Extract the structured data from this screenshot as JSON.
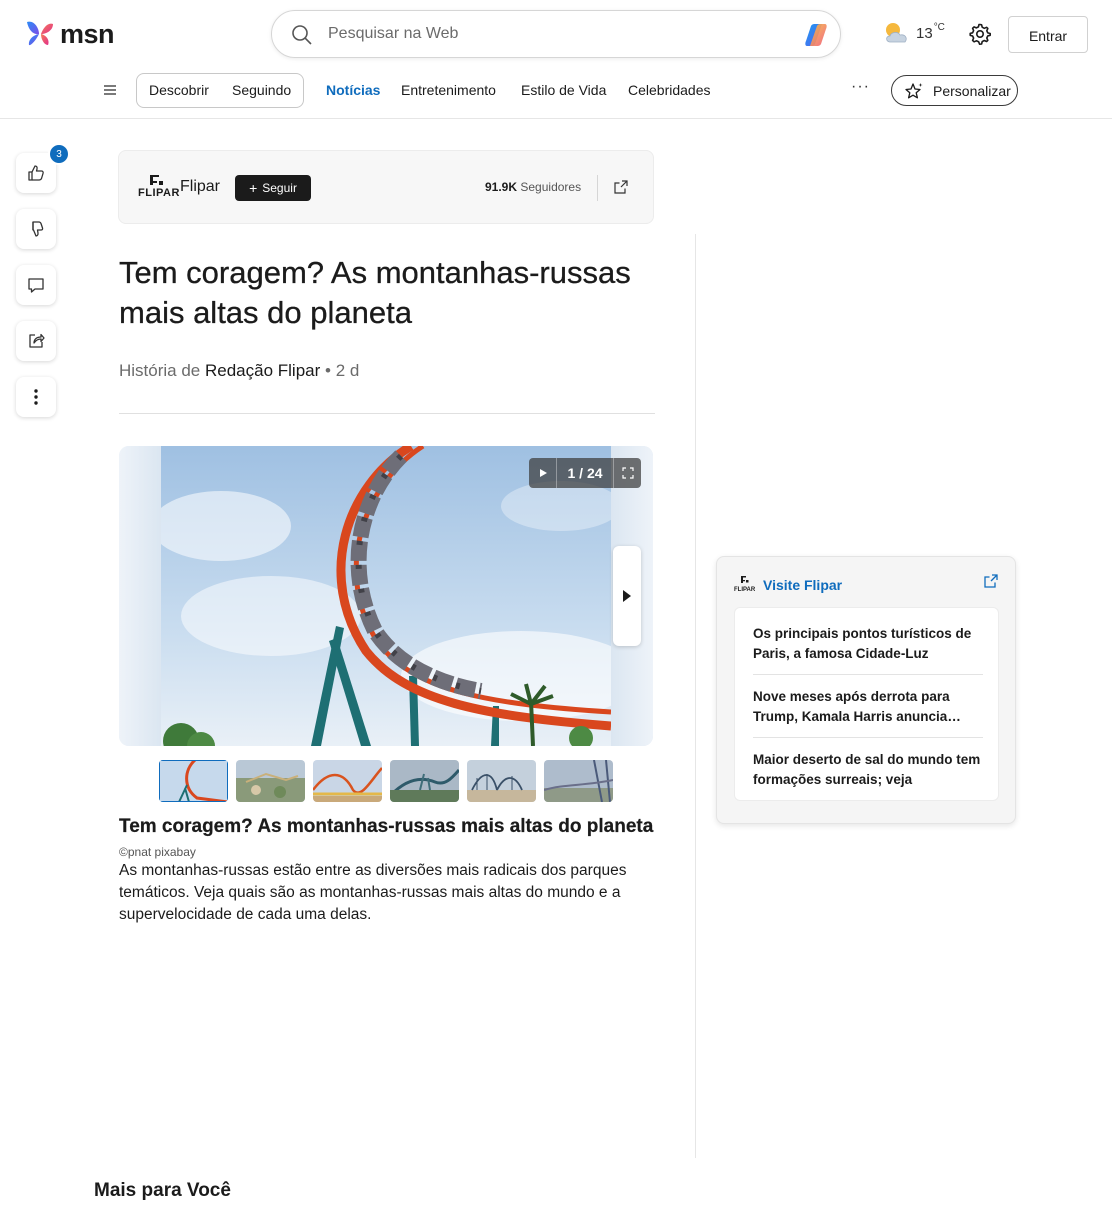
{
  "header": {
    "logo_text": "msn",
    "search_placeholder": "Pesquisar na Web",
    "weather": {
      "temp": "13",
      "unit": "°C",
      "icon": "partly-cloudy-icon"
    },
    "login_label": "Entrar"
  },
  "nav": {
    "segmented": [
      "Descobrir",
      "Seguindo"
    ],
    "links": [
      "Notícias",
      "Entretenimento",
      "Estilo de Vida",
      "Celebridades"
    ],
    "active_link": "Notícias",
    "more": "···",
    "personalize_label": "Personalizar"
  },
  "rail": {
    "like_count": "3"
  },
  "publisher": {
    "logo_text": "FLIPAR",
    "name": "Flipar",
    "follow_label": "Seguir",
    "followers_count": "91.9K",
    "followers_label": "Seguidores"
  },
  "article": {
    "title": "Tem coragem? As montanhas-russas mais altas do planeta",
    "byline_prefix": "História de",
    "author": "Redação Flipar",
    "age": "• 2 d"
  },
  "gallery": {
    "counter": "1 / 24",
    "caption_title": "Tem coragem? As montanhas-russas mais altas do planeta",
    "credit": "©pnat pixabay",
    "caption_body": "As montanhas-russas estão entre as diversões mais radicais dos parques temáticos. Veja quais são as montanhas-russas mais altas do mundo e a supervelocidade de cada uma delas."
  },
  "visit": {
    "title": "Visite Flipar",
    "items": [
      "Os principais pontos turísticos de Paris, a famosa Cidade-Luz",
      "Nove meses após derrota para Trump, Kamala Harris anuncia…",
      "Maior deserto de sal do mundo tem formações surreais; veja"
    ]
  },
  "more_for_you": "Mais para Você",
  "colors": {
    "accent": "#0f6cbd",
    "track": "#d9471e",
    "support": "#1e6f73"
  }
}
